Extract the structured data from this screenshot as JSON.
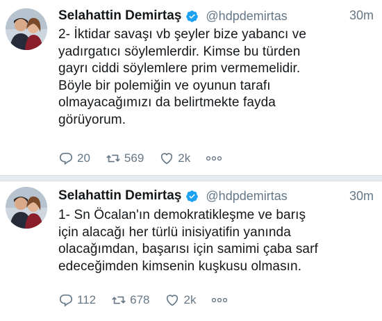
{
  "tweets": [
    {
      "name": "Selahattin Demirtaş",
      "handle": "@hdpdemirtas",
      "time": "30m",
      "text": "2- İktidar savaşı vb şeyler bize yabancı ve\nyadırgatıcı söylemlerdir. Kimse bu türden\ngayrı ciddi söylemlere prim vermemelidir.\nBöyle bir polemiğin ve oyunun tarafı\nolmayacağımızı da belirtmekte fayda\ngörüyorum.",
      "replies": "20",
      "retweets": "569",
      "likes": "2k"
    },
    {
      "name": "Selahattin Demirtaş",
      "handle": "@hdpdemirtas",
      "time": "30m",
      "text": "1- Sn Öcalan'ın demokratikleşme ve barış\niçin alacağı her türlü inisiyatifin yanında\nolacağımdan, başarısı için samimi çaba sarf\nedeceğimden kimsenin kuşkusu olmasın.",
      "replies": "112",
      "retweets": "678",
      "likes": "2k"
    }
  ],
  "colors": {
    "text": "#14171a",
    "secondary": "#657786",
    "verified": "#1da1f2",
    "divider": "#e6ecf0"
  },
  "icons": [
    "avatar",
    "verified-badge-icon",
    "reply-icon",
    "retweet-icon",
    "like-icon",
    "more-icon"
  ]
}
